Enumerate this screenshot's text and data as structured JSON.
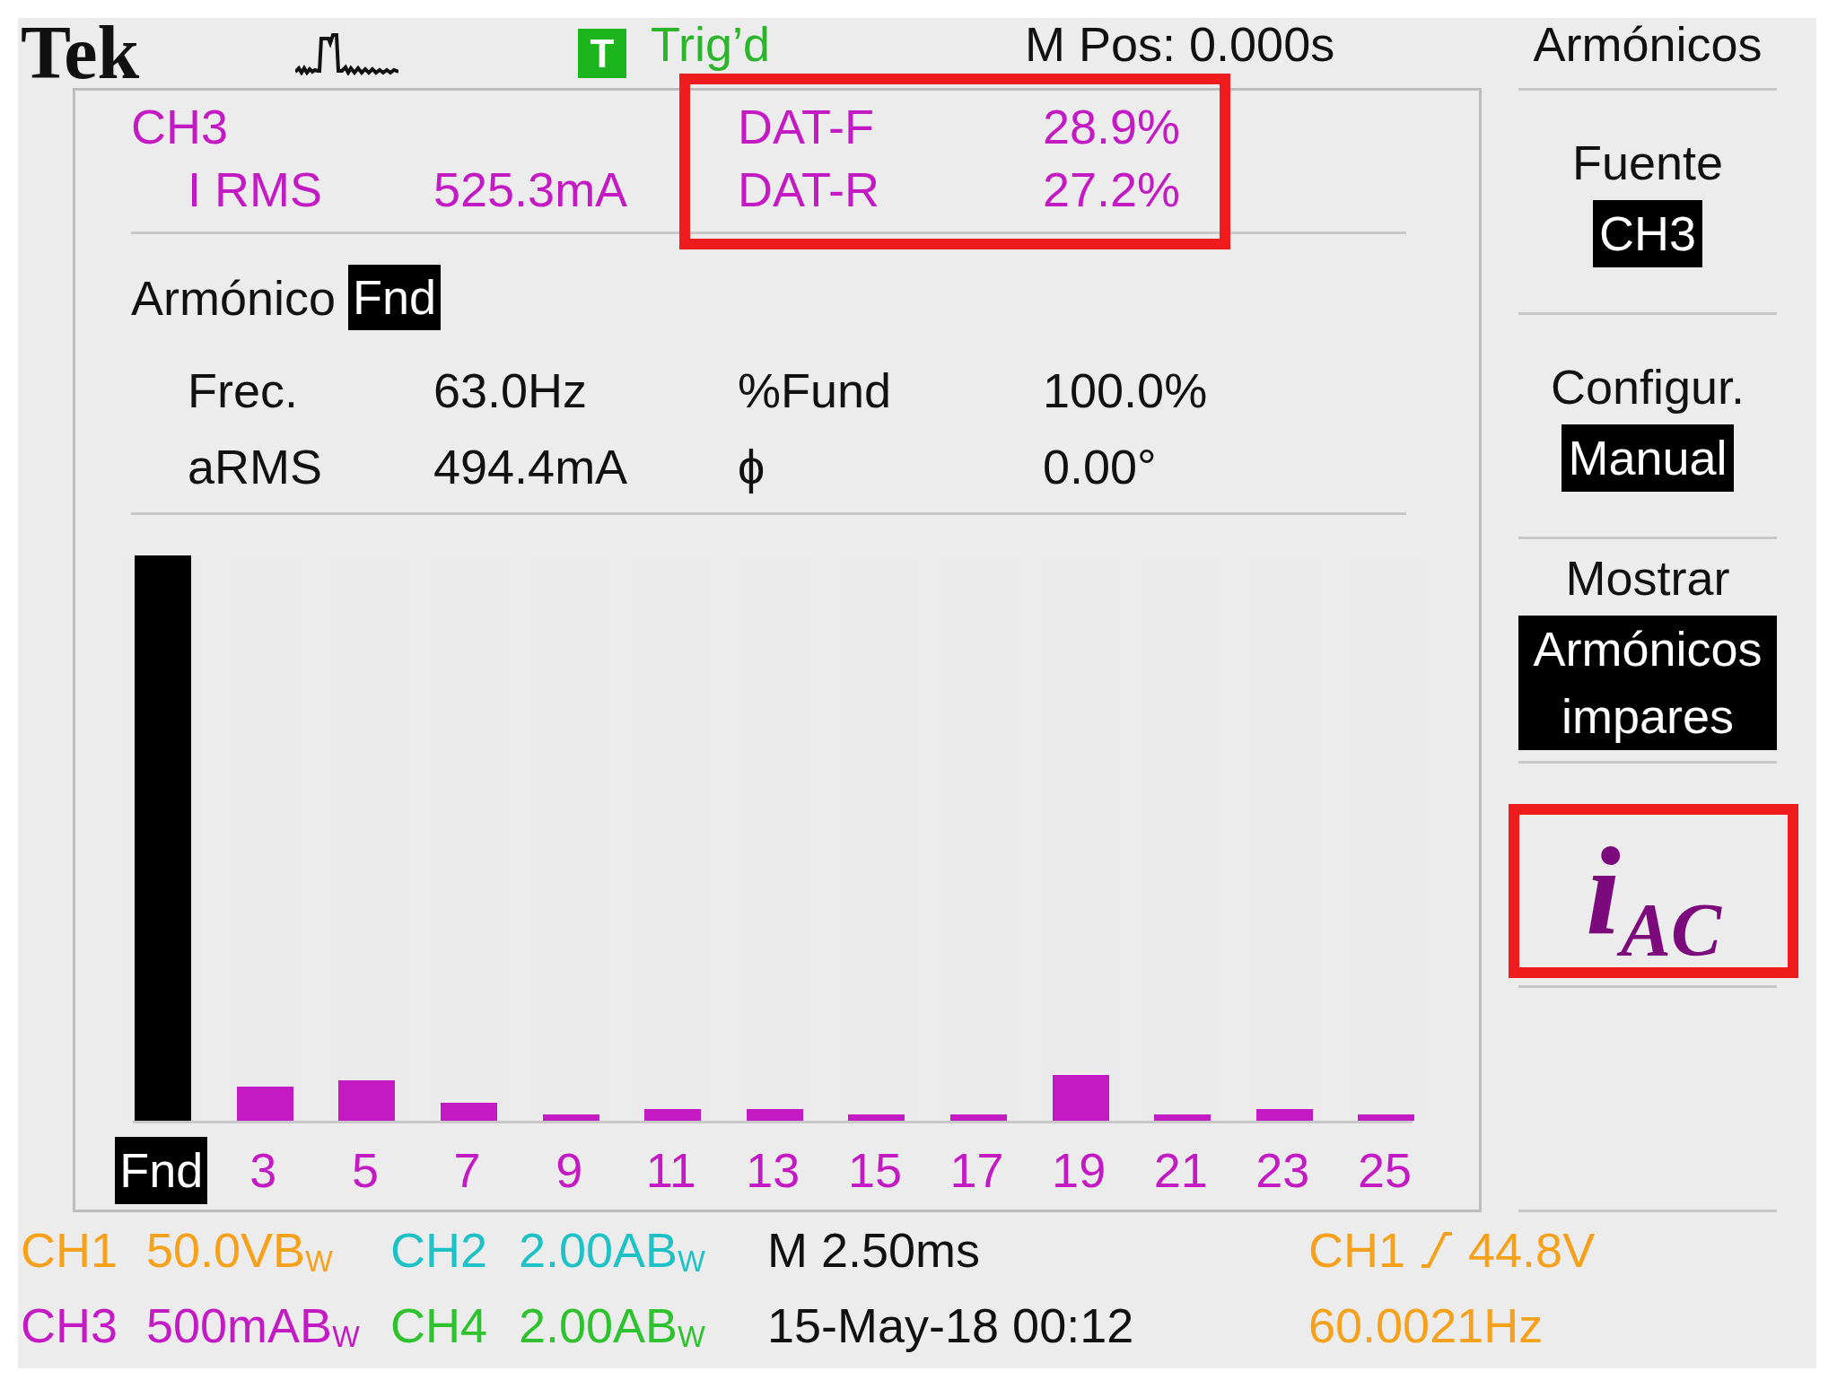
{
  "top_bar": {
    "logo": "Tek",
    "trigger_badge": "T",
    "trigger_status": "Trig’d",
    "position": "M Pos: 0.000s",
    "menu_title": "Armónicos"
  },
  "measurements": {
    "source": "CH3",
    "label": "I RMS",
    "value": "525.3mA",
    "distortion": {
      "highlighted": true,
      "rows": [
        {
          "label": "DAT-F",
          "value": "28.9%"
        },
        {
          "label": "DAT-R",
          "value": "27.2%"
        }
      ]
    }
  },
  "harmonic": {
    "label": "Armónico",
    "value": "Fnd",
    "readings": [
      {
        "label": "Frec.",
        "value": "63.0Hz"
      },
      {
        "label": "%Fund",
        "value": "100.0%"
      },
      {
        "label": "aRMS",
        "value": "494.4mA"
      },
      {
        "label": "ϕ",
        "value": "0.00°"
      }
    ]
  },
  "harmonic_bars": [
    {
      "label": "Fnd",
      "level": 1,
      "selected": true
    },
    {
      "label": "3",
      "level": 0.06,
      "selected": false
    },
    {
      "label": "5",
      "level": 0.071,
      "selected": false
    },
    {
      "label": "7",
      "level": 0.032,
      "selected": false
    },
    {
      "label": "9",
      "level": 0.011,
      "selected": false
    },
    {
      "label": "11",
      "level": 0.021,
      "selected": false
    },
    {
      "label": "13",
      "level": 0.021,
      "selected": false
    },
    {
      "label": "15",
      "level": 0.011,
      "selected": false
    },
    {
      "label": "17",
      "level": 0.011,
      "selected": false
    },
    {
      "label": "19",
      "level": 0.081,
      "selected": false
    },
    {
      "label": "21",
      "level": 0.011,
      "selected": false
    },
    {
      "label": "23",
      "level": 0.021,
      "selected": false
    },
    {
      "label": "25",
      "level": 0.011,
      "selected": false
    }
  ],
  "side_menu": {
    "items": [
      {
        "label": "Fuente",
        "value": "CH3"
      },
      {
        "label": "Configur.",
        "value": "Manual"
      },
      {
        "label": "Mostrar",
        "value": "Armónicos impares"
      }
    ],
    "annotation": {
      "text": "i$_{AC}$",
      "highlighted": true
    }
  },
  "status_bar": {
    "channels": [
      {
        "name": "CH1",
        "scale": "50.0VB$_{W}$",
        "color": "#f5a11c"
      },
      {
        "name": "CH2",
        "scale": "2.00AB$_{W}$",
        "color": "#1ec2c6"
      },
      {
        "name": "CH3",
        "scale": "500mAB$_{W}$",
        "color": "#c41ac4"
      },
      {
        "name": "CH4",
        "scale": "2.00AB$_{W}$",
        "color": "#2ec22e"
      }
    ],
    "timebase": "M 2.50ms",
    "date_time": "15-May-18 00:12",
    "trigger": {
      "source": "CH1",
      "threshold": "44.8V",
      "frequency": "60.0021Hz"
    }
  }
}
